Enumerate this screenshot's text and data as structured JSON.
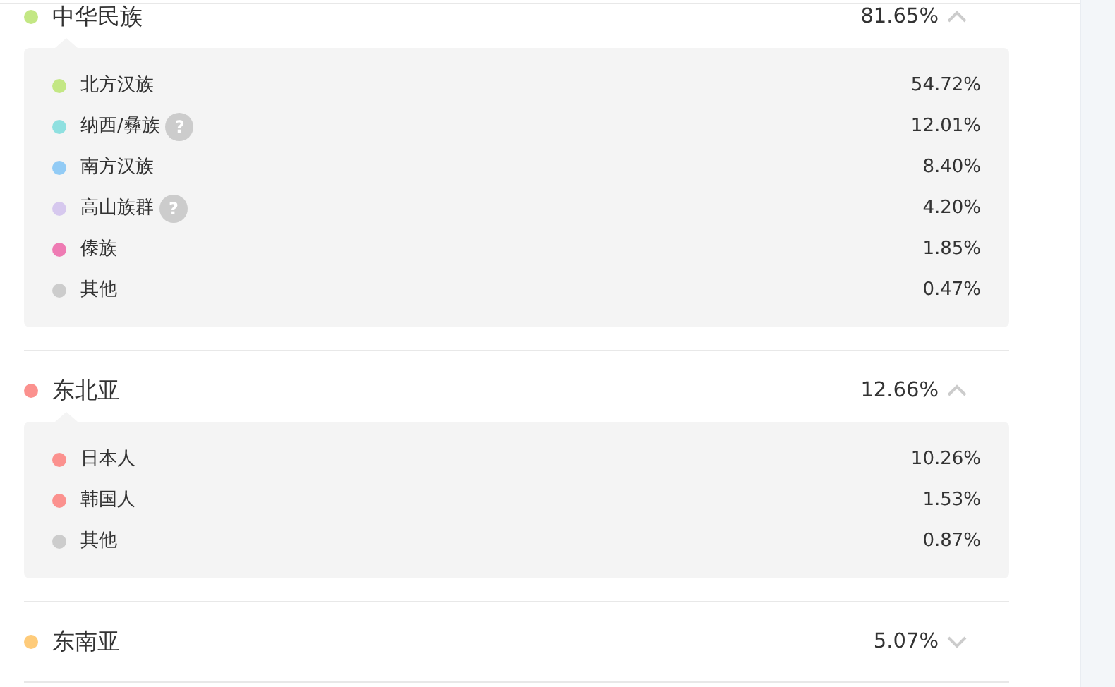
{
  "groups": [
    {
      "name": "中华民族",
      "color": "#c3e784",
      "percent": "81.65%",
      "expanded": true,
      "items": [
        {
          "name": "北方汉族",
          "color": "#c3e784",
          "percent": "54.72%"
        },
        {
          "name": "纳西/彝族",
          "color": "#8fe0e0",
          "percent": "12.01%",
          "help": "?"
        },
        {
          "name": "南方汉族",
          "color": "#92cbf5",
          "percent": "8.40%"
        },
        {
          "name": "高山族群",
          "color": "#d6c8ee",
          "percent": "4.20%",
          "help": "?"
        },
        {
          "name": "傣族",
          "color": "#ee7bb3",
          "percent": "1.85%"
        },
        {
          "name": "其他",
          "color": "#cccccc",
          "percent": "0.47%"
        }
      ]
    },
    {
      "name": "东北亚",
      "color": "#fb918e",
      "percent": "12.66%",
      "expanded": true,
      "items": [
        {
          "name": "日本人",
          "color": "#fb918e",
          "percent": "10.26%"
        },
        {
          "name": "韩国人",
          "color": "#fb918e",
          "percent": "1.53%"
        },
        {
          "name": "其他",
          "color": "#cccccc",
          "percent": "0.87%"
        }
      ]
    },
    {
      "name": "东南亚",
      "color": "#fecb7a",
      "percent": "5.07%",
      "expanded": false
    }
  ]
}
